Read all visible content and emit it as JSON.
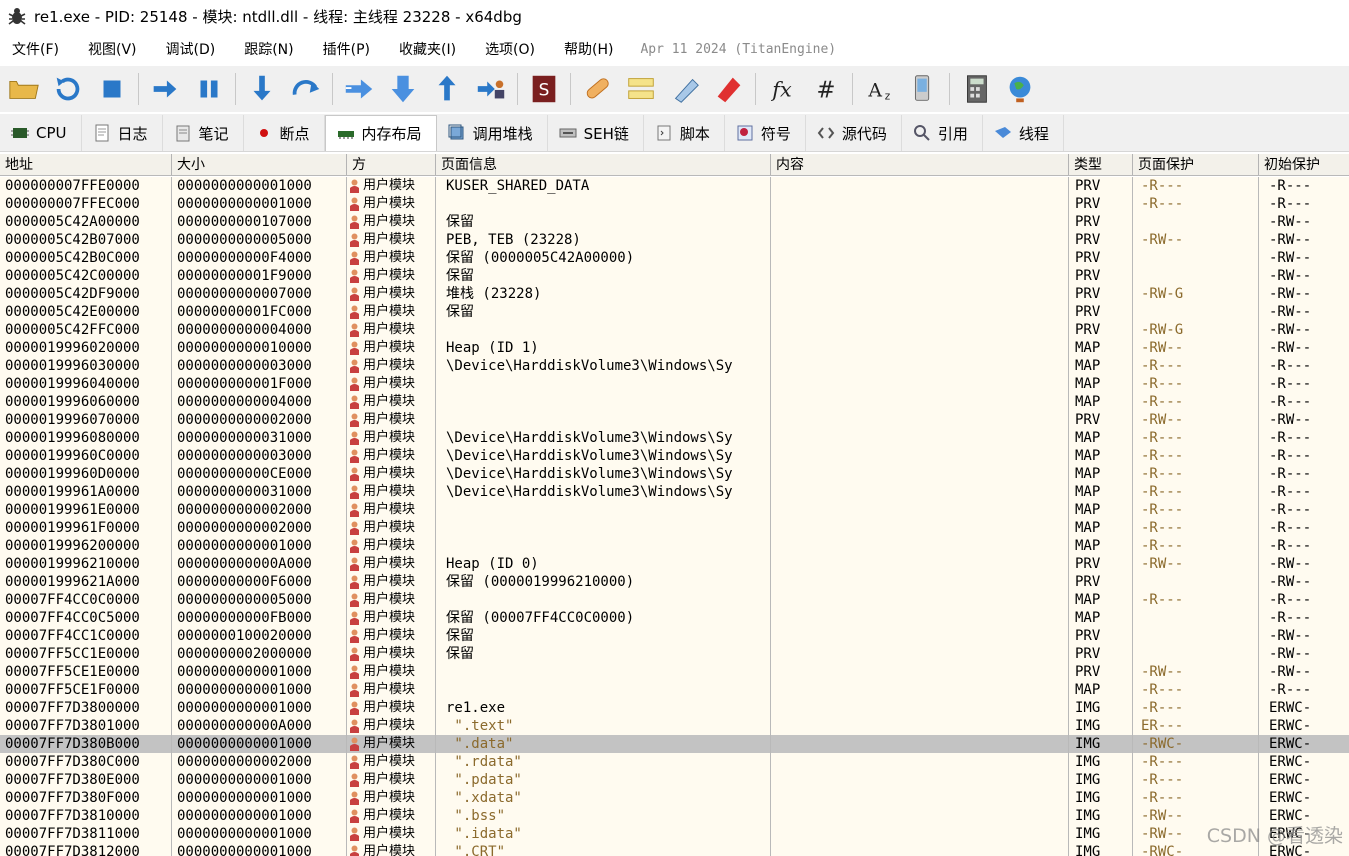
{
  "window": {
    "title": "re1.exe - PID: 25148 - 模块: ntdll.dll - 线程: 主线程 23228 - x64dbg"
  },
  "menu": {
    "items": [
      "文件(F)",
      "视图(V)",
      "调试(D)",
      "跟踪(N)",
      "插件(P)",
      "收藏夹(I)",
      "选项(O)",
      "帮助(H)"
    ],
    "date": "Apr 11 2024 (TitanEngine)"
  },
  "toolbar": {
    "icons": [
      "open-folder-icon",
      "restart-icon",
      "stop-icon",
      "run-icon",
      "pause-icon",
      "step-into-icon",
      "step-over-icon",
      "trace-into-icon",
      "trace-over-icon",
      "execute-till-return-icon",
      "run-to-user-code-icon",
      "scylla-icon",
      "patch-icon",
      "comment-icon",
      "label-icon",
      "bookmark-icon",
      "function-icon",
      "hash-icon",
      "font-size-icon",
      "device-icon",
      "calculator-icon",
      "globe-icon"
    ]
  },
  "tabs": [
    {
      "label": "CPU",
      "icon": "cpu-icon"
    },
    {
      "label": "日志",
      "icon": "log-icon"
    },
    {
      "label": "笔记",
      "icon": "notes-icon"
    },
    {
      "label": "断点",
      "icon": "breakpoint-icon"
    },
    {
      "label": "内存布局",
      "icon": "memory-map-icon",
      "active": true
    },
    {
      "label": "调用堆栈",
      "icon": "call-stack-icon"
    },
    {
      "label": "SEH链",
      "icon": "seh-chain-icon"
    },
    {
      "label": "脚本",
      "icon": "script-icon"
    },
    {
      "label": "符号",
      "icon": "symbols-icon"
    },
    {
      "label": "源代码",
      "icon": "source-icon"
    },
    {
      "label": "引用",
      "icon": "references-icon"
    },
    {
      "label": "线程",
      "icon": "threads-icon"
    }
  ],
  "columns": [
    "地址",
    "大小",
    "方",
    "页面信息",
    "内容",
    "类型",
    "页面保护",
    "初始保护"
  ],
  "rows": [
    {
      "addr": "000000007FFE0000",
      "size": "0000000000001000",
      "party": "用户模块",
      "info": "KUSER_SHARED_DATA",
      "type": "PRV",
      "prot": "-R---",
      "init": "-R---"
    },
    {
      "addr": "000000007FFEC000",
      "size": "0000000000001000",
      "party": "用户模块",
      "info": "",
      "type": "PRV",
      "prot": "-R---",
      "init": "-R---"
    },
    {
      "addr": "0000005C42A00000",
      "size": "0000000000107000",
      "party": "用户模块",
      "info": "保留",
      "type": "PRV",
      "prot": "",
      "init": "-RW--"
    },
    {
      "addr": "0000005C42B07000",
      "size": "0000000000005000",
      "party": "用户模块",
      "info": "PEB, TEB (23228)",
      "type": "PRV",
      "prot": "-RW--",
      "init": "-RW--"
    },
    {
      "addr": "0000005C42B0C000",
      "size": "00000000000F4000",
      "party": "用户模块",
      "info": "保留 (0000005C42A00000)",
      "type": "PRV",
      "prot": "",
      "init": "-RW--"
    },
    {
      "addr": "0000005C42C00000",
      "size": "00000000001F9000",
      "party": "用户模块",
      "info": "保留",
      "type": "PRV",
      "prot": "",
      "init": "-RW--"
    },
    {
      "addr": "0000005C42DF9000",
      "size": "0000000000007000",
      "party": "用户模块",
      "info": "堆栈 (23228)",
      "type": "PRV",
      "prot": "-RW-G",
      "init": "-RW--"
    },
    {
      "addr": "0000005C42E00000",
      "size": "00000000001FC000",
      "party": "用户模块",
      "info": "保留",
      "type": "PRV",
      "prot": "",
      "init": "-RW--"
    },
    {
      "addr": "0000005C42FFC000",
      "size": "0000000000004000",
      "party": "用户模块",
      "info": "",
      "type": "PRV",
      "prot": "-RW-G",
      "init": "-RW--"
    },
    {
      "addr": "0000019996020000",
      "size": "0000000000010000",
      "party": "用户模块",
      "info": "Heap (ID 1)",
      "type": "MAP",
      "prot": "-RW--",
      "init": "-RW--"
    },
    {
      "addr": "0000019996030000",
      "size": "0000000000003000",
      "party": "用户模块",
      "info": "\\Device\\HarddiskVolume3\\Windows\\Sy",
      "type": "MAP",
      "prot": "-R---",
      "init": "-R---"
    },
    {
      "addr": "0000019996040000",
      "size": "000000000001F000",
      "party": "用户模块",
      "info": "",
      "type": "MAP",
      "prot": "-R---",
      "init": "-R---"
    },
    {
      "addr": "0000019996060000",
      "size": "0000000000004000",
      "party": "用户模块",
      "info": "",
      "type": "MAP",
      "prot": "-R---",
      "init": "-R---"
    },
    {
      "addr": "0000019996070000",
      "size": "0000000000002000",
      "party": "用户模块",
      "info": "",
      "type": "PRV",
      "prot": "-RW--",
      "init": "-RW--"
    },
    {
      "addr": "0000019996080000",
      "size": "0000000000031000",
      "party": "用户模块",
      "info": "\\Device\\HarddiskVolume3\\Windows\\Sy",
      "type": "MAP",
      "prot": "-R---",
      "init": "-R---"
    },
    {
      "addr": "00000199960C0000",
      "size": "0000000000003000",
      "party": "用户模块",
      "info": "\\Device\\HarddiskVolume3\\Windows\\Sy",
      "type": "MAP",
      "prot": "-R---",
      "init": "-R---"
    },
    {
      "addr": "00000199960D0000",
      "size": "00000000000CE000",
      "party": "用户模块",
      "info": "\\Device\\HarddiskVolume3\\Windows\\Sy",
      "type": "MAP",
      "prot": "-R---",
      "init": "-R---"
    },
    {
      "addr": "00000199961A0000",
      "size": "0000000000031000",
      "party": "用户模块",
      "info": "\\Device\\HarddiskVolume3\\Windows\\Sy",
      "type": "MAP",
      "prot": "-R---",
      "init": "-R---"
    },
    {
      "addr": "00000199961E0000",
      "size": "0000000000002000",
      "party": "用户模块",
      "info": "",
      "type": "MAP",
      "prot": "-R---",
      "init": "-R---"
    },
    {
      "addr": "00000199961F0000",
      "size": "0000000000002000",
      "party": "用户模块",
      "info": "",
      "type": "MAP",
      "prot": "-R---",
      "init": "-R---"
    },
    {
      "addr": "0000019996200000",
      "size": "0000000000001000",
      "party": "用户模块",
      "info": "",
      "type": "MAP",
      "prot": "-R---",
      "init": "-R---"
    },
    {
      "addr": "0000019996210000",
      "size": "000000000000A000",
      "party": "用户模块",
      "info": "Heap (ID 0)",
      "type": "PRV",
      "prot": "-RW--",
      "init": "-RW--"
    },
    {
      "addr": "000001999621A000",
      "size": "00000000000F6000",
      "party": "用户模块",
      "info": "保留 (0000019996210000)",
      "type": "PRV",
      "prot": "",
      "init": "-RW--"
    },
    {
      "addr": "00007FF4CC0C0000",
      "size": "0000000000005000",
      "party": "用户模块",
      "info": "",
      "type": "MAP",
      "prot": "-R---",
      "init": "-R---"
    },
    {
      "addr": "00007FF4CC0C5000",
      "size": "00000000000FB000",
      "party": "用户模块",
      "info": "保留 (00007FF4CC0C0000)",
      "type": "MAP",
      "prot": "",
      "init": "-R---"
    },
    {
      "addr": "00007FF4CC1C0000",
      "size": "0000000100020000",
      "party": "用户模块",
      "info": "保留",
      "type": "PRV",
      "prot": "",
      "init": "-RW--"
    },
    {
      "addr": "00007FF5CC1E0000",
      "size": "0000000002000000",
      "party": "用户模块",
      "info": "保留",
      "type": "PRV",
      "prot": "",
      "init": "-RW--"
    },
    {
      "addr": "00007FF5CE1E0000",
      "size": "0000000000001000",
      "party": "用户模块",
      "info": "",
      "type": "PRV",
      "prot": "-RW--",
      "init": "-RW--"
    },
    {
      "addr": "00007FF5CE1F0000",
      "size": "0000000000001000",
      "party": "用户模块",
      "info": "",
      "type": "MAP",
      "prot": "-R---",
      "init": "-R---"
    },
    {
      "addr": "00007FF7D3800000",
      "size": "0000000000001000",
      "party": "用户模块",
      "info": "re1.exe",
      "type": "IMG",
      "prot": "-R---",
      "init": "ERWC-"
    },
    {
      "addr": "00007FF7D3801000",
      "size": "000000000000A000",
      "party": "用户模块",
      "info": " \".text\"",
      "type": "IMG",
      "prot": "ER---",
      "init": "ERWC-",
      "str": true
    },
    {
      "addr": "00007FF7D380B000",
      "size": "0000000000001000",
      "party": "用户模块",
      "info": " \".data\"",
      "type": "IMG",
      "prot": "-RWC-",
      "init": "ERWC-",
      "str": true,
      "selected": true
    },
    {
      "addr": "00007FF7D380C000",
      "size": "0000000000002000",
      "party": "用户模块",
      "info": " \".rdata\"",
      "type": "IMG",
      "prot": "-R---",
      "init": "ERWC-",
      "str": true
    },
    {
      "addr": "00007FF7D380E000",
      "size": "0000000000001000",
      "party": "用户模块",
      "info": " \".pdata\"",
      "type": "IMG",
      "prot": "-R---",
      "init": "ERWC-",
      "str": true
    },
    {
      "addr": "00007FF7D380F000",
      "size": "0000000000001000",
      "party": "用户模块",
      "info": " \".xdata\"",
      "type": "IMG",
      "prot": "-R---",
      "init": "ERWC-",
      "str": true
    },
    {
      "addr": "00007FF7D3810000",
      "size": "0000000000001000",
      "party": "用户模块",
      "info": " \".bss\"",
      "type": "IMG",
      "prot": "-RW--",
      "init": "ERWC-",
      "str": true
    },
    {
      "addr": "00007FF7D3811000",
      "size": "0000000000001000",
      "party": "用户模块",
      "info": " \".idata\"",
      "type": "IMG",
      "prot": "-RW--",
      "init": "ERWC-",
      "str": true
    },
    {
      "addr": "00007FF7D3812000",
      "size": "0000000000001000",
      "party": "用户模块",
      "info": " \".CRT\"",
      "type": "IMG",
      "prot": "-RWC-",
      "init": "ERWC-",
      "str": true
    }
  ],
  "watermark": "CSDN @看透染"
}
